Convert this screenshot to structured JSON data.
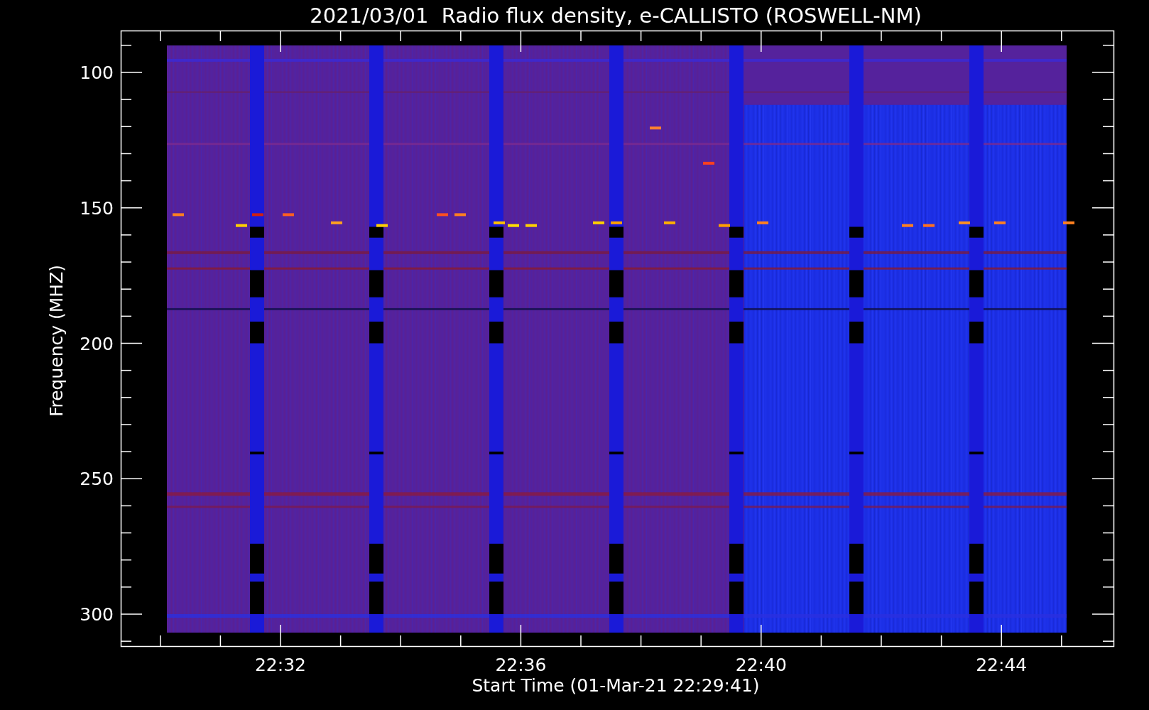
{
  "title": "2021/03/01  Radio flux density, e-CALLISTO (ROSWELL-NM)",
  "y_axis": {
    "label": "Frequency (MHZ)",
    "ticks": [
      "100",
      "150",
      "200",
      "250",
      "300"
    ]
  },
  "x_axis": {
    "label": "Start Time (01-Mar-21 22:29:41)",
    "ticks": [
      "22:32",
      "22:36",
      "22:40",
      "22:44"
    ]
  }
}
